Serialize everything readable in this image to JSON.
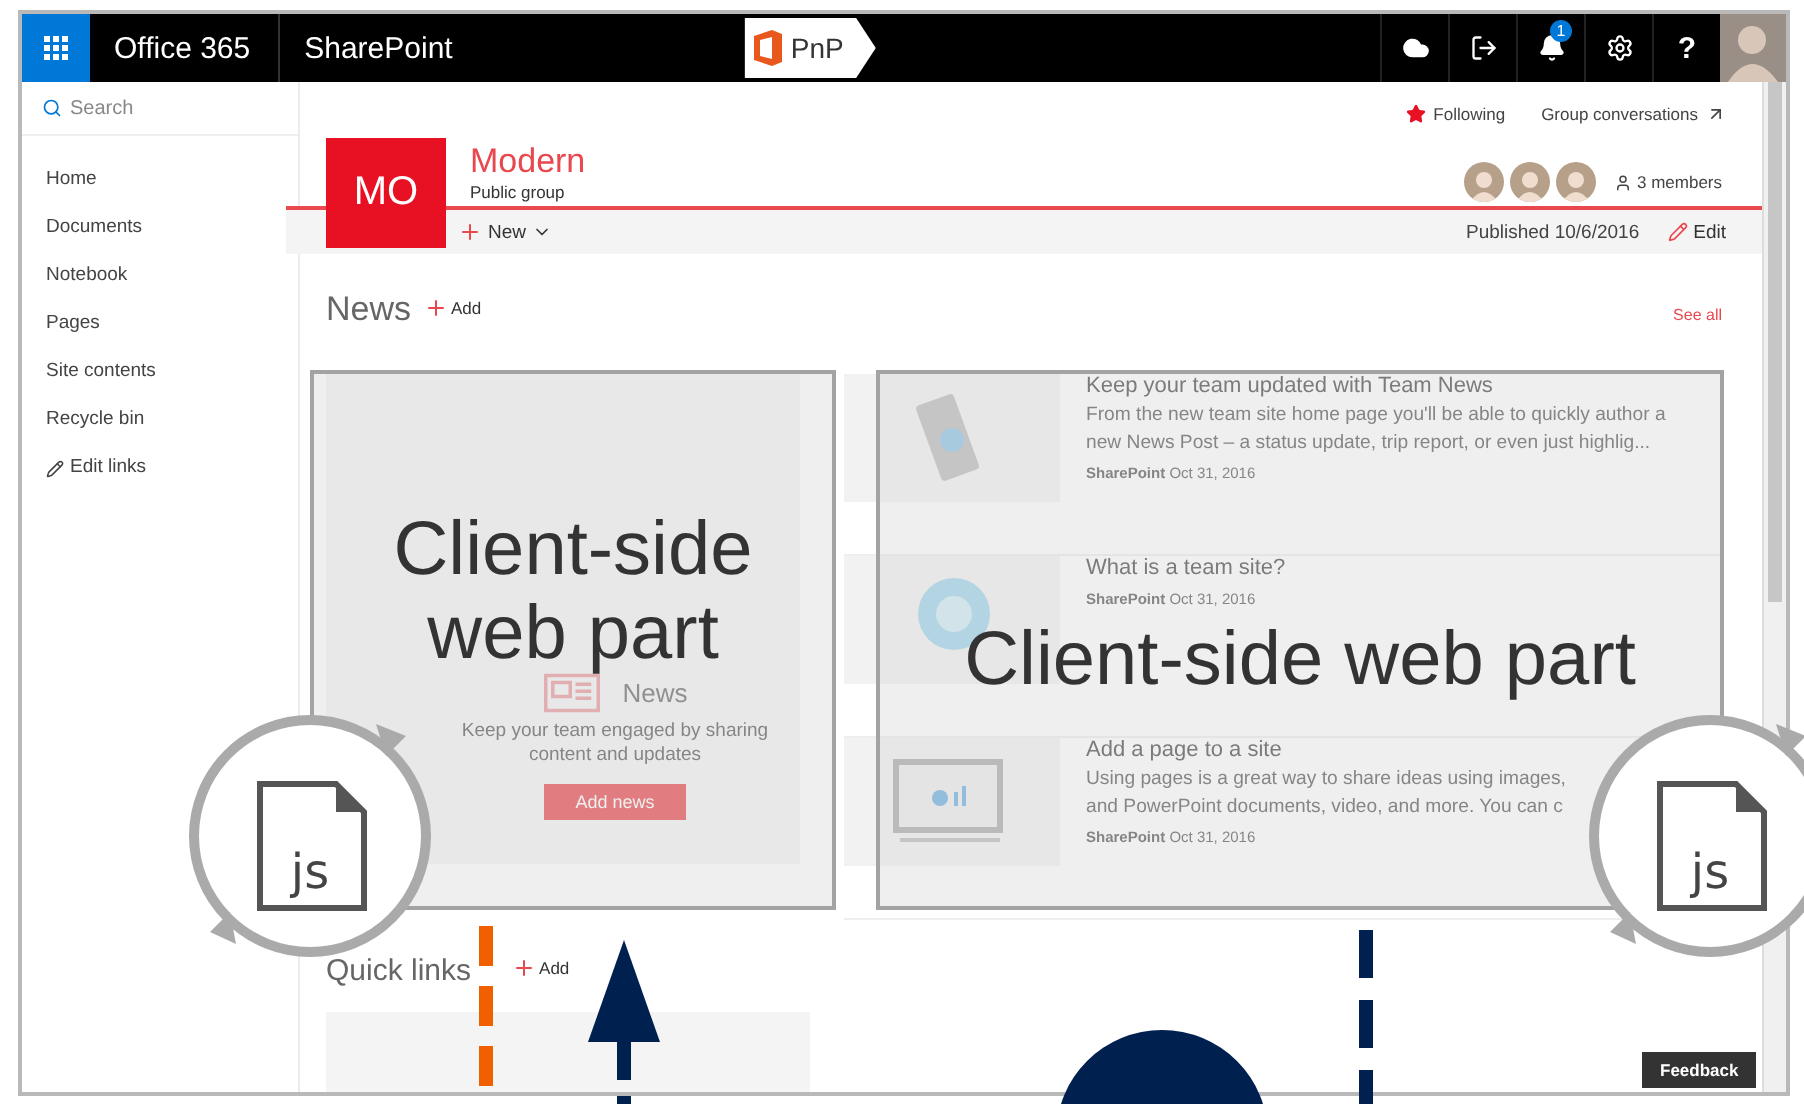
{
  "top_bar": {
    "app_name": "Office 365",
    "product": "SharePoint",
    "logo_text": "PnP",
    "notification_count": "1",
    "help": "?"
  },
  "nav": {
    "search_placeholder": "Search",
    "items": [
      {
        "label": "Home",
        "kind": "link"
      },
      {
        "label": "Documents",
        "kind": "link"
      },
      {
        "label": "Notebook",
        "kind": "link"
      },
      {
        "label": "Pages",
        "kind": "link"
      },
      {
        "label": "Site contents",
        "kind": "link"
      },
      {
        "label": "Recycle bin",
        "kind": "link"
      },
      {
        "label": "Edit links",
        "kind": "edit"
      }
    ]
  },
  "site_header": {
    "following": "Following",
    "conversations": "Group conversations",
    "logo_initials": "MO",
    "title": "Modern",
    "subtitle": "Public group",
    "members": "3 members"
  },
  "command_bar": {
    "new": "New",
    "published": "Published 10/6/2016",
    "edit": "Edit"
  },
  "news": {
    "heading": "News",
    "add": "Add",
    "see_all": "See all",
    "placeholder": {
      "title": "News",
      "text": "Keep your team engaged by sharing content and updates",
      "button": "Add news"
    },
    "items": [
      {
        "title": "Keep your team updated with Team News",
        "description": [
          "From the new team site home page you'll be able to quickly author a",
          "new News Post – a status update, trip report, or even just highlig..."
        ],
        "source": "SharePoint",
        "date": "Oct 31, 2016"
      },
      {
        "title": "What is a team site?",
        "source": "SharePoint",
        "date": "Oct 31, 2016"
      },
      {
        "title": "Add a page to a site",
        "description": [
          "Using pages is a great way to share ideas using images,",
          "and PowerPoint documents, video, and more. You can c"
        ],
        "source": "SharePoint",
        "date": "Oct 31, 2016"
      }
    ]
  },
  "quick_links": {
    "heading": "Quick links",
    "add": "Add"
  },
  "feedback": "Feedback",
  "diagram": {
    "web_parts": [
      {
        "label": "Client-side web part"
      },
      {
        "label": "Client-side web part"
      }
    ],
    "script_badges": [
      {
        "label": "js"
      },
      {
        "label": "js"
      }
    ]
  }
}
